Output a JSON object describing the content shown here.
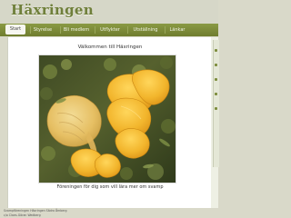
{
  "site": {
    "title": "Häxringen"
  },
  "nav": {
    "items": [
      {
        "label": "Start",
        "active": true
      },
      {
        "label": "Styrelse",
        "active": false
      },
      {
        "label": "Bli medlem",
        "active": false
      },
      {
        "label": "Utflykter",
        "active": false
      },
      {
        "label": "Utställning",
        "active": false
      },
      {
        "label": "Länkar",
        "active": false
      }
    ]
  },
  "main": {
    "welcome": "Välkommen till Häxringen",
    "caption": "Föreningen för dig som vill lära mer om svamp"
  },
  "footer": {
    "line1": "Svampföreningen Häxringen Sädra Åmberg",
    "line2": "c/o Claes-Göran Wedberg"
  },
  "colors": {
    "accent": "#7a8a38",
    "title": "#6f7f3a",
    "background": "#d9d9c9"
  }
}
